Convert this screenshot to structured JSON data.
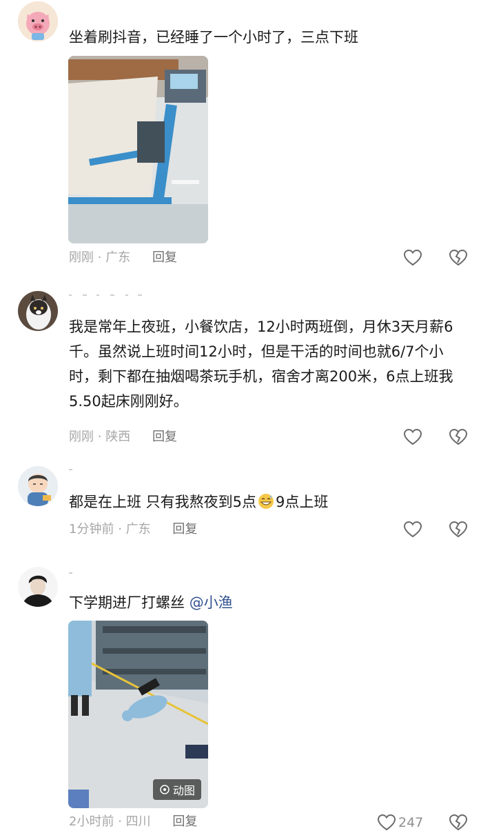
{
  "comments": [
    {
      "text": "坐着刷抖音，已经睡了一个小时了，三点下班",
      "time": "刚刚",
      "location": "广东",
      "reply_label": "回复"
    },
    {
      "text": "我是常年上夜班，小餐饮店，12小时两班倒，月休3天月薪6千。虽然说上班时间12小时，但是干活的时间也就6/7个小时，剩下都在抽烟喝茶玩手机，宿舍才离200米，6点上班我5.50起床刚刚好。",
      "time": "刚刚",
      "location": "陕西",
      "reply_label": "回复"
    },
    {
      "text_before": "都是在上班 只有我熬夜到5点",
      "emoji": "grinning-sweat-emoji",
      "text_after": "9点上班",
      "time": "1分钟前",
      "location": "广东",
      "reply_label": "回复"
    },
    {
      "text": "下学期进厂打螺丝",
      "mention": "@小渔",
      "time": "2小时前",
      "location": "四川",
      "reply_label": "回复",
      "like_count": "247",
      "media_badge": "动图"
    }
  ],
  "separator": "·",
  "colors": {
    "text": "#1a1a1a",
    "meta": "#a6a6a6",
    "mention": "#31518f",
    "icon": "#6a6a6a"
  },
  "icons": {
    "like": "heart-outline-icon",
    "dislike": "broken-heart-icon",
    "gif": "gif-play-icon"
  }
}
